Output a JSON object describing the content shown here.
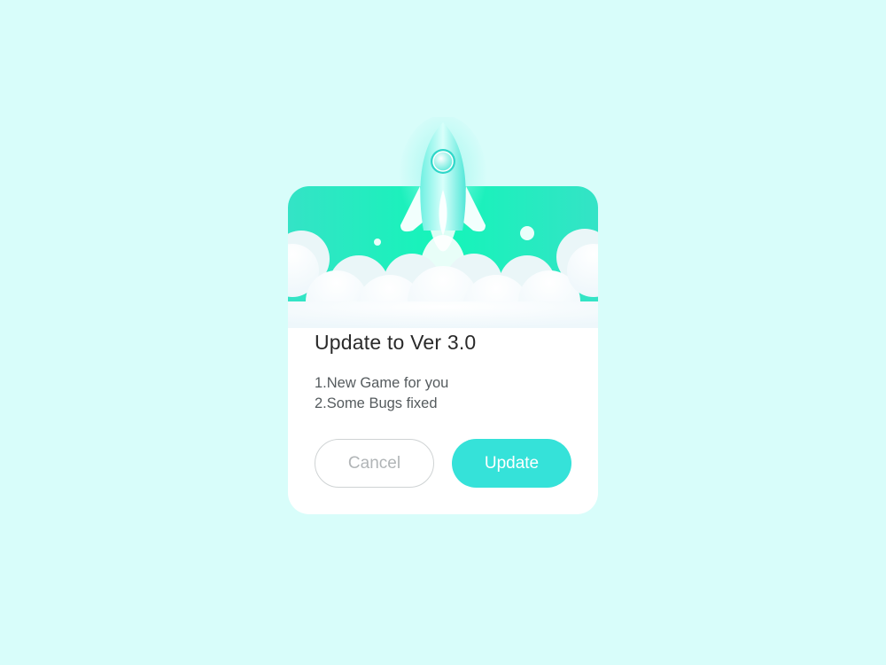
{
  "dialog": {
    "title": "Update to Ver 3.0",
    "notes": [
      "1.New Game for you",
      "2.Some Bugs fixed"
    ],
    "cancel_label": "Cancel",
    "update_label": "Update"
  },
  "colors": {
    "page_background": "#d8fdfa",
    "hero_gradient_start": "#34e3c6",
    "hero_gradient_end": "#14f5b9",
    "primary_button": "#35e2d9",
    "title_text": "#2a2a2a",
    "cancel_border": "#cfd3d4"
  },
  "icons": {
    "illustration": "rocket-launch-icon"
  }
}
